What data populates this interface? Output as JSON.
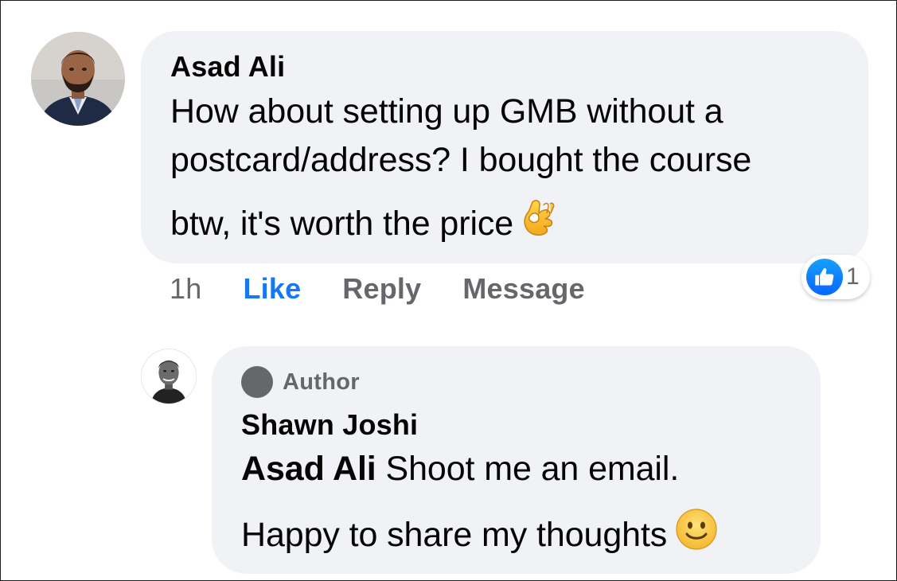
{
  "comment": {
    "author": "Asad Ali",
    "avatar_icon": "profile-photo-asad-ali",
    "lines": [
      "How about setting up GMB without a",
      "postcard/address? I bought the course",
      "btw, it's worth the price"
    ],
    "emoji_icon": "ok-hand-emoji",
    "timestamp": "1h",
    "actions": {
      "like": "Like",
      "reply": "Reply",
      "message": "Message"
    },
    "reactions": {
      "icon": "like-reaction-icon",
      "count": "1"
    }
  },
  "reply": {
    "badge": "Author",
    "author": "Shawn Joshi",
    "avatar_icon": "profile-photo-shawn-joshi",
    "mention": "Asad Ali",
    "line1_rest": " Shoot me an email.",
    "line2": "Happy to share my thoughts",
    "emoji_icon": "slightly-smiling-face-emoji"
  },
  "colors": {
    "bubble": "#f0f2f5",
    "like_blue": "#1877f2",
    "muted": "#65676b"
  }
}
